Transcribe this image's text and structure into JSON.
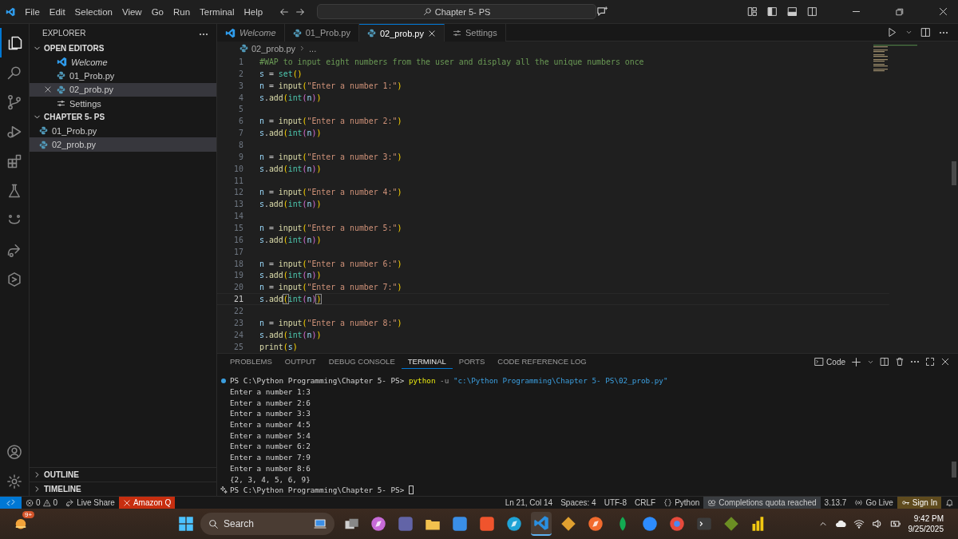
{
  "title_bar": {
    "menu": [
      "File",
      "Edit",
      "Selection",
      "View",
      "Go",
      "Run",
      "Terminal",
      "Help"
    ],
    "command_center": "Chapter 5- PS"
  },
  "activity_bar": [
    {
      "kind": "files",
      "selected": true
    },
    {
      "kind": "search",
      "selected": false
    },
    {
      "kind": "branch",
      "selected": false
    },
    {
      "kind": "debug",
      "selected": false
    },
    {
      "kind": "blocks",
      "selected": false
    },
    {
      "kind": "flask",
      "selected": false
    },
    {
      "kind": "smile",
      "selected": false
    },
    {
      "kind": "share",
      "selected": false
    },
    {
      "kind": "hexagon",
      "selected": false
    },
    {
      "kind": "account",
      "selected": false
    },
    {
      "kind": "gear",
      "selected": false
    }
  ],
  "explorer": {
    "title": "EXPLORER",
    "open_editors": {
      "title": "OPEN EDITORS",
      "expanded": true,
      "items": [
        {
          "label": "Welcome",
          "kind": "welcome",
          "selected": false
        },
        {
          "label": "01_Prob.py",
          "kind": "python",
          "selected": false
        },
        {
          "label": "02_prob.py",
          "kind": "python",
          "selected": true
        },
        {
          "label": "Settings",
          "kind": "settings",
          "selected": false
        }
      ]
    },
    "folder": {
      "title": "CHAPTER 5- PS",
      "expanded": true,
      "items": [
        {
          "label": "01_Prob.py",
          "kind": "python",
          "selected": false
        },
        {
          "label": "02_prob.py",
          "kind": "python",
          "selected": true
        }
      ]
    },
    "sections": [
      {
        "title": "OUTLINE",
        "expanded": false
      },
      {
        "title": "TIMELINE",
        "expanded": false
      }
    ]
  },
  "editor_tabs": [
    {
      "label": "Welcome",
      "kind": "welcome",
      "selected": false
    },
    {
      "label": "01_Prob.py",
      "kind": "python",
      "selected": false
    },
    {
      "label": "02_prob.py",
      "kind": "python",
      "selected": true
    },
    {
      "label": "Settings",
      "kind": "settings",
      "selected": false
    }
  ],
  "breadcrumb": {
    "file": "02_prob.py",
    "rest": "..."
  },
  "code_lines": [
    {
      "number": "1",
      "current": false,
      "tokens": [
        {
          "kind": "comment",
          "text": "#WAP to input eight numbers from the user and display all the unique numbers once"
        }
      ]
    },
    {
      "number": "2",
      "current": false,
      "tokens": [
        {
          "kind": "var",
          "text": "s"
        },
        {
          "kind": "plain",
          "text": " = "
        },
        {
          "kind": "builtin",
          "text": "set"
        },
        {
          "kind": "b1",
          "text": "()"
        }
      ]
    },
    {
      "number": "3",
      "current": false,
      "tokens": [
        {
          "kind": "var",
          "text": "n"
        },
        {
          "kind": "plain",
          "text": " = "
        },
        {
          "kind": "fn",
          "text": "input"
        },
        {
          "kind": "b1",
          "text": "("
        },
        {
          "kind": "str",
          "text": "\"Enter a number 1:\""
        },
        {
          "kind": "b1",
          "text": ")"
        }
      ]
    },
    {
      "number": "4",
      "current": false,
      "tokens": [
        {
          "kind": "var",
          "text": "s"
        },
        {
          "kind": "plain",
          "text": "."
        },
        {
          "kind": "fn",
          "text": "add"
        },
        {
          "kind": "b1",
          "text": "("
        },
        {
          "kind": "builtin",
          "text": "int"
        },
        {
          "kind": "b2",
          "text": "("
        },
        {
          "kind": "var",
          "text": "n"
        },
        {
          "kind": "b2",
          "text": ")"
        },
        {
          "kind": "b1",
          "text": ")"
        }
      ]
    },
    {
      "number": "5",
      "current": false
    },
    {
      "number": "6",
      "current": false,
      "tokens": [
        {
          "kind": "var",
          "text": "n"
        },
        {
          "kind": "plain",
          "text": " = "
        },
        {
          "kind": "fn",
          "text": "input"
        },
        {
          "kind": "b1",
          "text": "("
        },
        {
          "kind": "str",
          "text": "\"Enter a number 2:\""
        },
        {
          "kind": "b1",
          "text": ")"
        }
      ]
    },
    {
      "number": "7",
      "current": false,
      "tokens": [
        {
          "kind": "var",
          "text": "s"
        },
        {
          "kind": "plain",
          "text": "."
        },
        {
          "kind": "fn",
          "text": "add"
        },
        {
          "kind": "b1",
          "text": "("
        },
        {
          "kind": "builtin",
          "text": "int"
        },
        {
          "kind": "b2",
          "text": "("
        },
        {
          "kind": "var",
          "text": "n"
        },
        {
          "kind": "b2",
          "text": ")"
        },
        {
          "kind": "b1",
          "text": ")"
        }
      ]
    },
    {
      "number": "8",
      "current": false
    },
    {
      "number": "9",
      "current": false,
      "tokens": [
        {
          "kind": "var",
          "text": "n"
        },
        {
          "kind": "plain",
          "text": " = "
        },
        {
          "kind": "fn",
          "text": "input"
        },
        {
          "kind": "b1",
          "text": "("
        },
        {
          "kind": "str",
          "text": "\"Enter a number 3:\""
        },
        {
          "kind": "b1",
          "text": ")"
        }
      ]
    },
    {
      "number": "10",
      "current": false,
      "tokens": [
        {
          "kind": "var",
          "text": "s"
        },
        {
          "kind": "plain",
          "text": "."
        },
        {
          "kind": "fn",
          "text": "add"
        },
        {
          "kind": "b1",
          "text": "("
        },
        {
          "kind": "builtin",
          "text": "int"
        },
        {
          "kind": "b2",
          "text": "("
        },
        {
          "kind": "var",
          "text": "n"
        },
        {
          "kind": "b2",
          "text": ")"
        },
        {
          "kind": "b1",
          "text": ")"
        }
      ]
    },
    {
      "number": "11",
      "current": false
    },
    {
      "number": "12",
      "current": false,
      "tokens": [
        {
          "kind": "var",
          "text": "n"
        },
        {
          "kind": "plain",
          "text": " = "
        },
        {
          "kind": "fn",
          "text": "input"
        },
        {
          "kind": "b1",
          "text": "("
        },
        {
          "kind": "str",
          "text": "\"Enter a number 4:\""
        },
        {
          "kind": "b1",
          "text": ")"
        }
      ]
    },
    {
      "number": "13",
      "current": false,
      "tokens": [
        {
          "kind": "var",
          "text": "s"
        },
        {
          "kind": "plain",
          "text": "."
        },
        {
          "kind": "fn",
          "text": "add"
        },
        {
          "kind": "b1",
          "text": "("
        },
        {
          "kind": "builtin",
          "text": "int"
        },
        {
          "kind": "b2",
          "text": "("
        },
        {
          "kind": "var",
          "text": "n"
        },
        {
          "kind": "b2",
          "text": ")"
        },
        {
          "kind": "b1",
          "text": ")"
        }
      ]
    },
    {
      "number": "14",
      "current": false
    },
    {
      "number": "15",
      "current": false,
      "tokens": [
        {
          "kind": "var",
          "text": "n"
        },
        {
          "kind": "plain",
          "text": " = "
        },
        {
          "kind": "fn",
          "text": "input"
        },
        {
          "kind": "b1",
          "text": "("
        },
        {
          "kind": "str",
          "text": "\"Enter a number 5:\""
        },
        {
          "kind": "b1",
          "text": ")"
        }
      ]
    },
    {
      "number": "16",
      "current": false,
      "tokens": [
        {
          "kind": "var",
          "text": "s"
        },
        {
          "kind": "plain",
          "text": "."
        },
        {
          "kind": "fn",
          "text": "add"
        },
        {
          "kind": "b1",
          "text": "("
        },
        {
          "kind": "builtin",
          "text": "int"
        },
        {
          "kind": "b2",
          "text": "("
        },
        {
          "kind": "var",
          "text": "n"
        },
        {
          "kind": "b2",
          "text": ")"
        },
        {
          "kind": "b1",
          "text": ")"
        }
      ]
    },
    {
      "number": "17",
      "current": false
    },
    {
      "number": "18",
      "current": false,
      "tokens": [
        {
          "kind": "var",
          "text": "n"
        },
        {
          "kind": "plain",
          "text": " = "
        },
        {
          "kind": "fn",
          "text": "input"
        },
        {
          "kind": "b1",
          "text": "("
        },
        {
          "kind": "str",
          "text": "\"Enter a number 6:\""
        },
        {
          "kind": "b1",
          "text": ")"
        }
      ]
    },
    {
      "number": "19",
      "current": false,
      "tokens": [
        {
          "kind": "var",
          "text": "s"
        },
        {
          "kind": "plain",
          "text": "."
        },
        {
          "kind": "fn",
          "text": "add"
        },
        {
          "kind": "b1",
          "text": "("
        },
        {
          "kind": "builtin",
          "text": "int"
        },
        {
          "kind": "b2",
          "text": "("
        },
        {
          "kind": "var",
          "text": "n"
        },
        {
          "kind": "b2",
          "text": ")"
        },
        {
          "kind": "b1",
          "text": ")"
        }
      ]
    },
    {
      "number": "20",
      "current": false,
      "tokens": [
        {
          "kind": "var",
          "text": "n"
        },
        {
          "kind": "plain",
          "text": " = "
        },
        {
          "kind": "fn",
          "text": "input"
        },
        {
          "kind": "b1",
          "text": "("
        },
        {
          "kind": "str",
          "text": "\"Enter a number 7:\""
        },
        {
          "kind": "b1",
          "text": ")"
        }
      ]
    },
    {
      "number": "21",
      "current": true,
      "tokens": [
        {
          "kind": "var",
          "text": "s"
        },
        {
          "kind": "plain",
          "text": "."
        },
        {
          "kind": "fn",
          "text": "add"
        },
        {
          "kind": "b1-match",
          "text": "("
        },
        {
          "kind": "builtin",
          "text": "int"
        },
        {
          "kind": "b2",
          "text": "("
        },
        {
          "kind": "var",
          "text": "n"
        },
        {
          "kind": "b2",
          "text": ")"
        },
        {
          "kind": "b1-match",
          "text": ")"
        }
      ]
    },
    {
      "number": "22",
      "current": false
    },
    {
      "number": "23",
      "current": false,
      "tokens": [
        {
          "kind": "var",
          "text": "n"
        },
        {
          "kind": "plain",
          "text": " = "
        },
        {
          "kind": "fn",
          "text": "input"
        },
        {
          "kind": "b1",
          "text": "("
        },
        {
          "kind": "str",
          "text": "\"Enter a number 8:\""
        },
        {
          "kind": "b1",
          "text": ")"
        }
      ]
    },
    {
      "number": "24",
      "current": false,
      "tokens": [
        {
          "kind": "var",
          "text": "s"
        },
        {
          "kind": "plain",
          "text": "."
        },
        {
          "kind": "fn",
          "text": "add"
        },
        {
          "kind": "b1",
          "text": "("
        },
        {
          "kind": "builtin",
          "text": "int"
        },
        {
          "kind": "b2",
          "text": "("
        },
        {
          "kind": "var",
          "text": "n"
        },
        {
          "kind": "b2",
          "text": ")"
        },
        {
          "kind": "b1",
          "text": ")"
        }
      ]
    },
    {
      "number": "25",
      "current": false,
      "tokens": [
        {
          "kind": "fn",
          "text": "print"
        },
        {
          "kind": "b1",
          "text": "("
        },
        {
          "kind": "var",
          "text": "s"
        },
        {
          "kind": "b1",
          "text": ")"
        }
      ]
    }
  ],
  "panel": {
    "tabs": [
      {
        "label": "PROBLEMS",
        "selected": false
      },
      {
        "label": "OUTPUT",
        "selected": false
      },
      {
        "label": "DEBUG CONSOLE",
        "selected": false
      },
      {
        "label": "TERMINAL",
        "selected": true
      },
      {
        "label": "PORTS",
        "selected": false
      },
      {
        "label": "CODE REFERENCE LOG",
        "selected": false
      }
    ],
    "terminal_profile": "Code",
    "terminal_lines": [
      {
        "kind": "command",
        "cursor": false,
        "tokens": [
          {
            "kind": "plain",
            "text": "PS C:\\Python Programming\\Chapter 5- PS> "
          },
          {
            "kind": "cmd",
            "text": "python"
          },
          {
            "kind": "flag",
            "text": " -u "
          },
          {
            "kind": "path",
            "text": "\"c:\\Python Programming\\Chapter 5- PS\\02_prob.py\""
          }
        ]
      },
      {
        "kind": "output",
        "cursor": false,
        "tokens": [
          {
            "kind": "plain",
            "text": "Enter a number 1:3"
          }
        ]
      },
      {
        "kind": "output",
        "cursor": false,
        "tokens": [
          {
            "kind": "plain",
            "text": "Enter a number 2:6"
          }
        ]
      },
      {
        "kind": "output",
        "cursor": false,
        "tokens": [
          {
            "kind": "plain",
            "text": "Enter a number 3:3"
          }
        ]
      },
      {
        "kind": "output",
        "cursor": false,
        "tokens": [
          {
            "kind": "plain",
            "text": "Enter a number 4:5"
          }
        ]
      },
      {
        "kind": "output",
        "cursor": false,
        "tokens": [
          {
            "kind": "plain",
            "text": "Enter a number 5:4"
          }
        ]
      },
      {
        "kind": "output",
        "cursor": false,
        "tokens": [
          {
            "kind": "plain",
            "text": "Enter a number 6:2"
          }
        ]
      },
      {
        "kind": "output",
        "cursor": false,
        "tokens": [
          {
            "kind": "plain",
            "text": "Enter a number 7:9"
          }
        ]
      },
      {
        "kind": "output",
        "cursor": false,
        "tokens": [
          {
            "kind": "plain",
            "text": "Enter a number 8:6"
          }
        ]
      },
      {
        "kind": "output",
        "cursor": false,
        "tokens": [
          {
            "kind": "plain",
            "text": "{2, 3, 4, 5, 6, 9}"
          }
        ]
      },
      {
        "kind": "prompt",
        "cursor": true,
        "tokens": [
          {
            "kind": "plain",
            "text": "PS C:\\Python Programming\\Chapter 5- PS> "
          }
        ]
      }
    ]
  },
  "status_bar": {
    "left": [
      {
        "kind": "remote"
      },
      {
        "kind": "problems",
        "errors": "0",
        "warnings": "0"
      },
      {
        "kind": "live-share",
        "label": "Live Share"
      },
      {
        "kind": "alert",
        "label": "Amazon Q"
      }
    ],
    "right": [
      {
        "kind": "text",
        "label": "Ln 21, Col 14"
      },
      {
        "kind": "text",
        "label": "Spaces: 4"
      },
      {
        "kind": "text",
        "label": "UTF-8"
      },
      {
        "kind": "text",
        "label": "CRLF"
      },
      {
        "kind": "language",
        "label": "Python"
      },
      {
        "kind": "quota",
        "label": "Completions quota reached"
      },
      {
        "kind": "text",
        "label": "3.13.7"
      },
      {
        "kind": "go-live",
        "label": "Go Live"
      },
      {
        "kind": "sign-in",
        "label": "Sign In"
      },
      {
        "kind": "bell"
      }
    ]
  },
  "taskbar": {
    "weather_badge": "9+",
    "search_label": "Search",
    "apps": [
      {
        "kind": "task-view",
        "color": "#cfcfcf",
        "selected": false
      },
      {
        "kind": "copilot",
        "color": "#c86bd8",
        "selected": false
      },
      {
        "kind": "teams",
        "color": "#6264a7",
        "selected": false
      },
      {
        "kind": "folder",
        "color": "#f2c14e",
        "selected": false
      },
      {
        "kind": "store",
        "color": "#3a8ee6",
        "selected": false
      },
      {
        "kind": "brave",
        "color": "#f0542d",
        "selected": false
      },
      {
        "kind": "edge",
        "color": "#1fa3d6",
        "selected": false
      },
      {
        "kind": "vscode",
        "color": "#2a8fe0",
        "selected": true
      },
      {
        "kind": "diamond",
        "color": "#e0a030",
        "selected": false
      },
      {
        "kind": "compass",
        "color": "#f26b2e",
        "selected": false
      },
      {
        "kind": "leaf",
        "color": "#13aa52",
        "selected": false
      },
      {
        "kind": "circle",
        "color": "#2d8cff",
        "selected": false
      },
      {
        "kind": "chrome",
        "color": "#e64a3c",
        "selected": false
      },
      {
        "kind": "terminal",
        "color": "#3c3c3c",
        "selected": false
      },
      {
        "kind": "diamond",
        "color": "#6b8e23",
        "selected": false
      },
      {
        "kind": "bars",
        "color": "#f2c811",
        "selected": false
      }
    ],
    "time": "9:42 PM",
    "date": "9/25/2025"
  }
}
